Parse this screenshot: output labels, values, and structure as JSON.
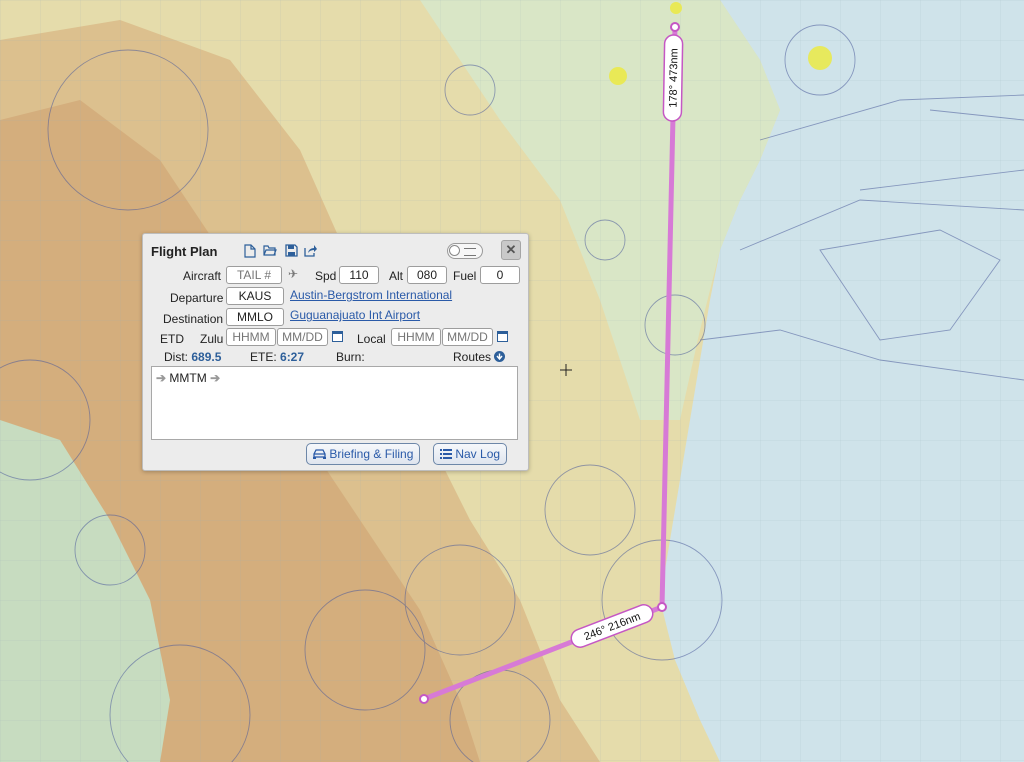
{
  "map": {
    "legs": [
      {
        "label": "178° 473nm"
      },
      {
        "label": "246° 216nm"
      }
    ],
    "colors": {
      "route": "#d77ad6",
      "sea": "#cfe3ea",
      "land": "#e3d9a8",
      "terrain": "#d6b585",
      "airspace": "#4a5a9a"
    }
  },
  "flight_plan": {
    "title": "Flight Plan",
    "toolbar_icons": [
      "new-file-icon",
      "open-folder-icon",
      "save-icon",
      "share-icon"
    ],
    "aircraft_label": "Aircraft",
    "aircraft_placeholder": "TAIL #",
    "spd_label": "Spd",
    "spd_value": "110",
    "alt_label": "Alt",
    "alt_value": "080",
    "fuel_label": "Fuel",
    "fuel_value": "0",
    "departure_label": "Departure",
    "departure_code": "KAUS",
    "departure_name": "Austin-Bergstrom International",
    "destination_label": "Destination",
    "destination_code": "MMLO",
    "destination_name": "Guguanajuato Int Airport",
    "etd_label": "ETD",
    "zulu_label": "Zulu",
    "local_label": "Local",
    "time_placeholder": "HHMM",
    "date_placeholder": "MM/DD",
    "dist_label": "Dist:",
    "dist_value": "689.5",
    "ete_label": "ETE:",
    "ete_value": "6:27",
    "burn_label": "Burn:",
    "routes_label": "Routes",
    "route_waypoint": "MMTM",
    "briefing_button": "Briefing & Filing",
    "navlog_button": "Nav Log"
  }
}
